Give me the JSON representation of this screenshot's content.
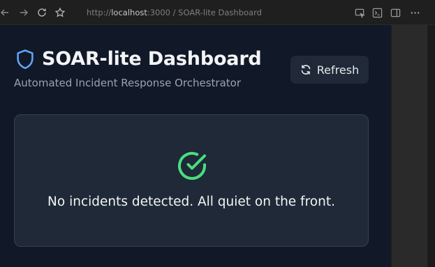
{
  "browser": {
    "url_prefix": "http://",
    "url_host": "localhost",
    "url_rest": ":3000 / SOAR-lite Dashboard"
  },
  "header": {
    "title": "SOAR-lite Dashboard",
    "subtitle": "Automated Incident Response Orchestrator",
    "refresh_label": "Refresh"
  },
  "empty_state": {
    "message": "No incidents detected. All quiet on the front."
  },
  "colors": {
    "page_bg": "#111827",
    "card_bg": "#1f2937",
    "accent_blue": "#60a5fa",
    "success_green": "#4ade80"
  },
  "icons": {
    "brand": "shield-icon",
    "refresh": "refresh-icon",
    "status": "check-circle-icon"
  }
}
